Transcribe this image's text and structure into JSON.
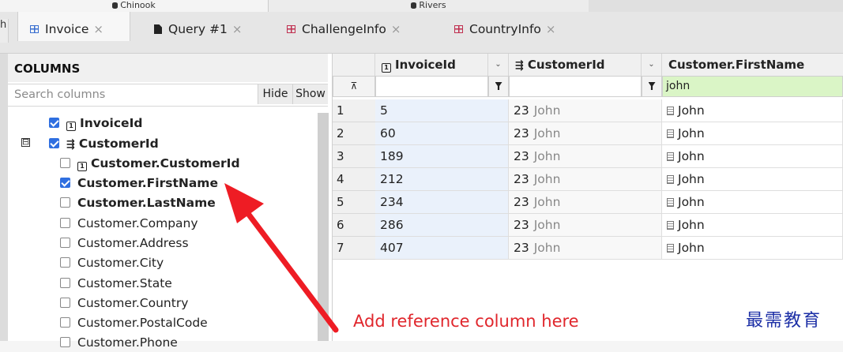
{
  "connections": {
    "active": "Chinook",
    "inactive": "Rivers"
  },
  "tabs": [
    {
      "label": "Invoice",
      "close": "×"
    },
    {
      "label": "Query #1",
      "close": "×"
    },
    {
      "label": "ChallengeInfo",
      "close": "×"
    },
    {
      "label": "CountryInfo",
      "close": "×"
    }
  ],
  "left_stub": "h",
  "columns_panel": {
    "title": "COLUMNS",
    "search_placeholder": "Search columns",
    "hide_label": "Hide",
    "show_label": "Show",
    "expander": "⊟",
    "items": [
      {
        "label": "InvoiceId",
        "checked": true
      },
      {
        "label": "CustomerId",
        "checked": true
      },
      {
        "label": "Customer.CustomerId",
        "checked": false
      },
      {
        "label": "Customer.FirstName",
        "checked": true
      },
      {
        "label": "Customer.LastName",
        "checked": false
      },
      {
        "label": "Customer.Company",
        "checked": false
      },
      {
        "label": "Customer.Address",
        "checked": false
      },
      {
        "label": "Customer.City",
        "checked": false
      },
      {
        "label": "Customer.State",
        "checked": false
      },
      {
        "label": "Customer.Country",
        "checked": false
      },
      {
        "label": "Customer.PostalCode",
        "checked": false
      },
      {
        "label": "Customer.Phone",
        "checked": false
      }
    ]
  },
  "grid": {
    "headers": [
      "InvoiceId",
      "CustomerId",
      "Customer.FirstName"
    ],
    "filter_value": "john",
    "rows": [
      {
        "n": "1",
        "invoice": "5",
        "cust": "23",
        "cust_name": "John",
        "first": "John"
      },
      {
        "n": "2",
        "invoice": "60",
        "cust": "23",
        "cust_name": "John",
        "first": "John"
      },
      {
        "n": "3",
        "invoice": "189",
        "cust": "23",
        "cust_name": "John",
        "first": "John"
      },
      {
        "n": "4",
        "invoice": "212",
        "cust": "23",
        "cust_name": "John",
        "first": "John"
      },
      {
        "n": "5",
        "invoice": "234",
        "cust": "23",
        "cust_name": "John",
        "first": "John"
      },
      {
        "n": "6",
        "invoice": "286",
        "cust": "23",
        "cust_name": "John",
        "first": "John"
      },
      {
        "n": "7",
        "invoice": "407",
        "cust": "23",
        "cust_name": "John",
        "first": "John"
      }
    ]
  },
  "annotation": {
    "text": "Add reference column here",
    "color": "#e0262c"
  },
  "watermark": "最需教育"
}
